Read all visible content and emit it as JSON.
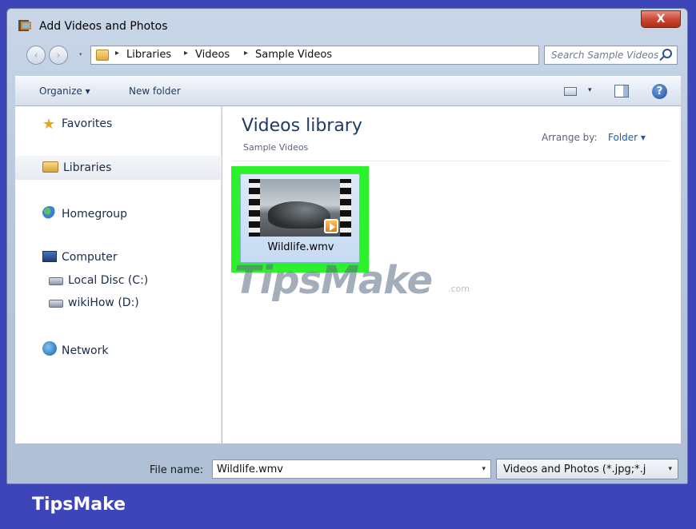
{
  "window": {
    "title": "Add Videos and Photos",
    "close_label": "X"
  },
  "address_bar": {
    "back_glyph": "‹",
    "forward_glyph": "›",
    "breadcrumbs": [
      "Libraries",
      "Videos",
      "Sample Videos"
    ],
    "separator": "▸",
    "dropdown_glyph": "▾",
    "refresh_glyph": "↺"
  },
  "search": {
    "placeholder": "Search Sample Videos"
  },
  "toolbar": {
    "organize_label": "Organize ▾",
    "new_folder_label": "New folder",
    "view_dropdown": "▾",
    "help_glyph": "?"
  },
  "navigation": {
    "favorites": "Favorites",
    "libraries": "Libraries",
    "homegroup": "Homegroup",
    "computer": "Computer",
    "local_disc": "Local Disc (C:)",
    "wikihow_drive": "wikiHow (D:)",
    "network": "Network",
    "star_glyph": "★"
  },
  "library": {
    "title": "Videos library",
    "subtitle": "Sample Videos",
    "arrange_label": "Arrange by:",
    "arrange_value": "Folder ▾"
  },
  "files": [
    {
      "name": "Wildlife.wmv"
    }
  ],
  "footer": {
    "file_name_label": "File name:",
    "file_name_value": "Wildlife.wmv",
    "file_type_value": "Videos and Photos (*.jpg;*.j",
    "dropdown_glyph": "▾"
  },
  "branding": {
    "watermark": "TipsMake",
    "watermark_suffix": ".com",
    "footer_brand": "TipsMake"
  },
  "colors": {
    "highlight": "#2cf22c",
    "brand_bar": "#3d45b8",
    "close_button": "#c94a35",
    "link": "#1f5aa8"
  }
}
